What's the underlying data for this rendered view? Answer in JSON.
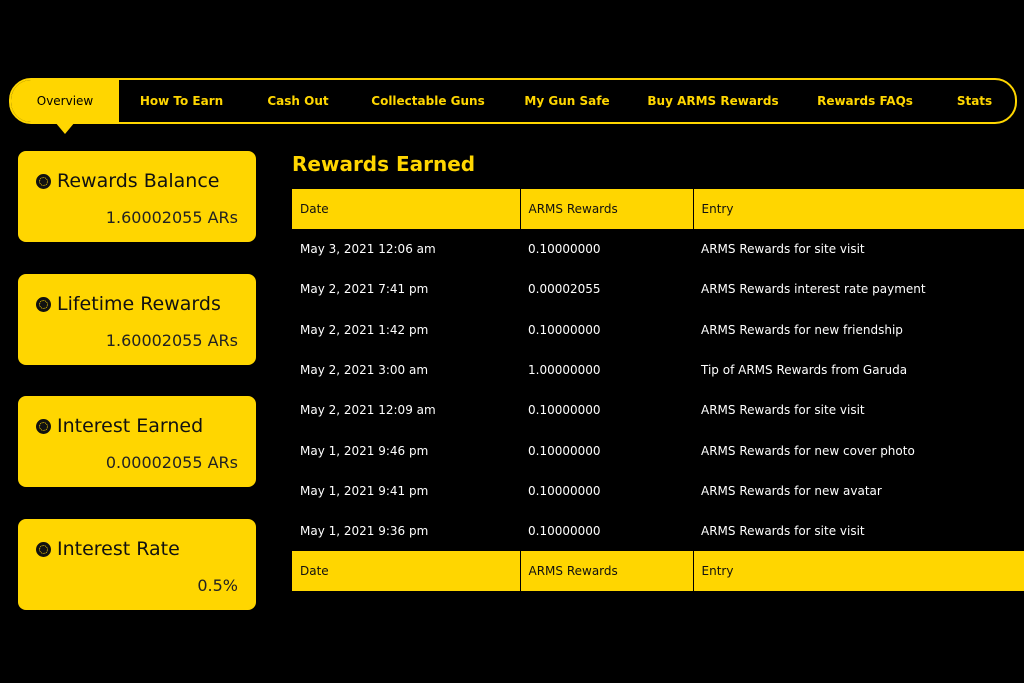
{
  "nav": {
    "tabs": [
      {
        "label": "Overview",
        "active": true
      },
      {
        "label": "How To Earn",
        "active": false
      },
      {
        "label": "Cash Out",
        "active": false
      },
      {
        "label": "Collectable Guns",
        "active": false
      },
      {
        "label": "My Gun Safe",
        "active": false
      },
      {
        "label": "Buy ARMS Rewards",
        "active": false
      },
      {
        "label": "Rewards FAQs",
        "active": false
      },
      {
        "label": "Stats",
        "active": false
      }
    ]
  },
  "cards": [
    {
      "title": "Rewards Balance",
      "value": "1.60002055 ARs"
    },
    {
      "title": "Lifetime Rewards",
      "value": "1.60002055 ARs"
    },
    {
      "title": "Interest Earned",
      "value": "0.00002055 ARs"
    },
    {
      "title": "Interest Rate",
      "value": "0.5%"
    }
  ],
  "rewards": {
    "title": "Rewards Earned",
    "columns": [
      "Date",
      "ARMS Rewards",
      "Entry"
    ],
    "rows": [
      [
        "May 3, 2021 12:06 am",
        "0.10000000",
        "ARMS Rewards for site visit"
      ],
      [
        "May 2, 2021 7:41 pm",
        "0.00002055",
        "ARMS Rewards interest rate payment"
      ],
      [
        "May 2, 2021 1:42 pm",
        "0.10000000",
        "ARMS Rewards for new friendship"
      ],
      [
        "May 2, 2021 3:00 am",
        "1.00000000",
        "Tip of ARMS Rewards from Garuda"
      ],
      [
        "May 2, 2021 12:09 am",
        "0.10000000",
        "ARMS Rewards for site visit"
      ],
      [
        "May 1, 2021 9:46 pm",
        "0.10000000",
        "ARMS Rewards for new cover photo"
      ],
      [
        "May 1, 2021 9:41 pm",
        "0.10000000",
        "ARMS Rewards for new avatar"
      ],
      [
        "May 1, 2021 9:36 pm",
        "0.10000000",
        "ARMS Rewards for site visit"
      ]
    ]
  },
  "colors": {
    "accent": "#FFD600",
    "background": "#000000"
  },
  "icons": {
    "card_icon": "coin-icon",
    "active_tab_indicator": "caret-down-icon"
  }
}
